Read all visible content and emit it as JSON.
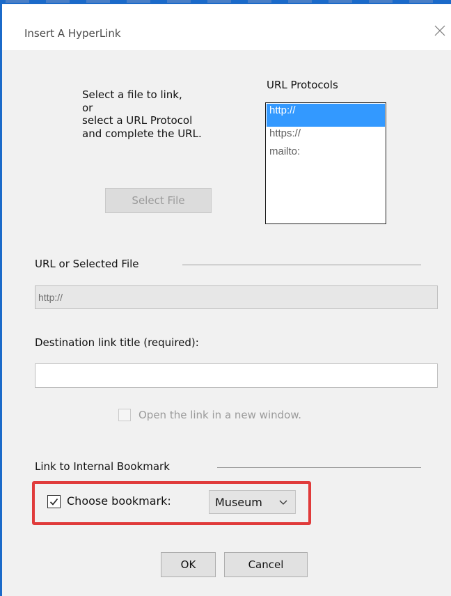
{
  "window": {
    "title": "Insert A HyperLink"
  },
  "file_section": {
    "instructions": [
      "Select a file to link,",
      "or",
      "select a URL Protocol",
      "and complete the URL."
    ],
    "select_file_label": "Select File"
  },
  "protocols": {
    "label": "URL Protocols",
    "items": [
      {
        "label": "http://",
        "selected": true
      },
      {
        "label": "https://",
        "selected": false
      },
      {
        "label": "mailto:",
        "selected": false
      }
    ]
  },
  "url_group": {
    "label": "URL or Selected File",
    "value": "http://"
  },
  "destination": {
    "label": "Destination link title (required):",
    "value": ""
  },
  "new_window": {
    "label": "Open the link in a new window.",
    "checked": false,
    "enabled": false
  },
  "bookmark_group": {
    "label": "Link to Internal Bookmark",
    "choose_label": "Choose bookmark:",
    "checked": true,
    "selected_bookmark": "Museum"
  },
  "buttons": {
    "ok": "OK",
    "cancel": "Cancel"
  },
  "colors": {
    "frame_accent": "#1b6ac9",
    "selection": "#3399ff",
    "highlight_border": "#e03b3b",
    "dialog_bg": "#f1f1f1"
  }
}
